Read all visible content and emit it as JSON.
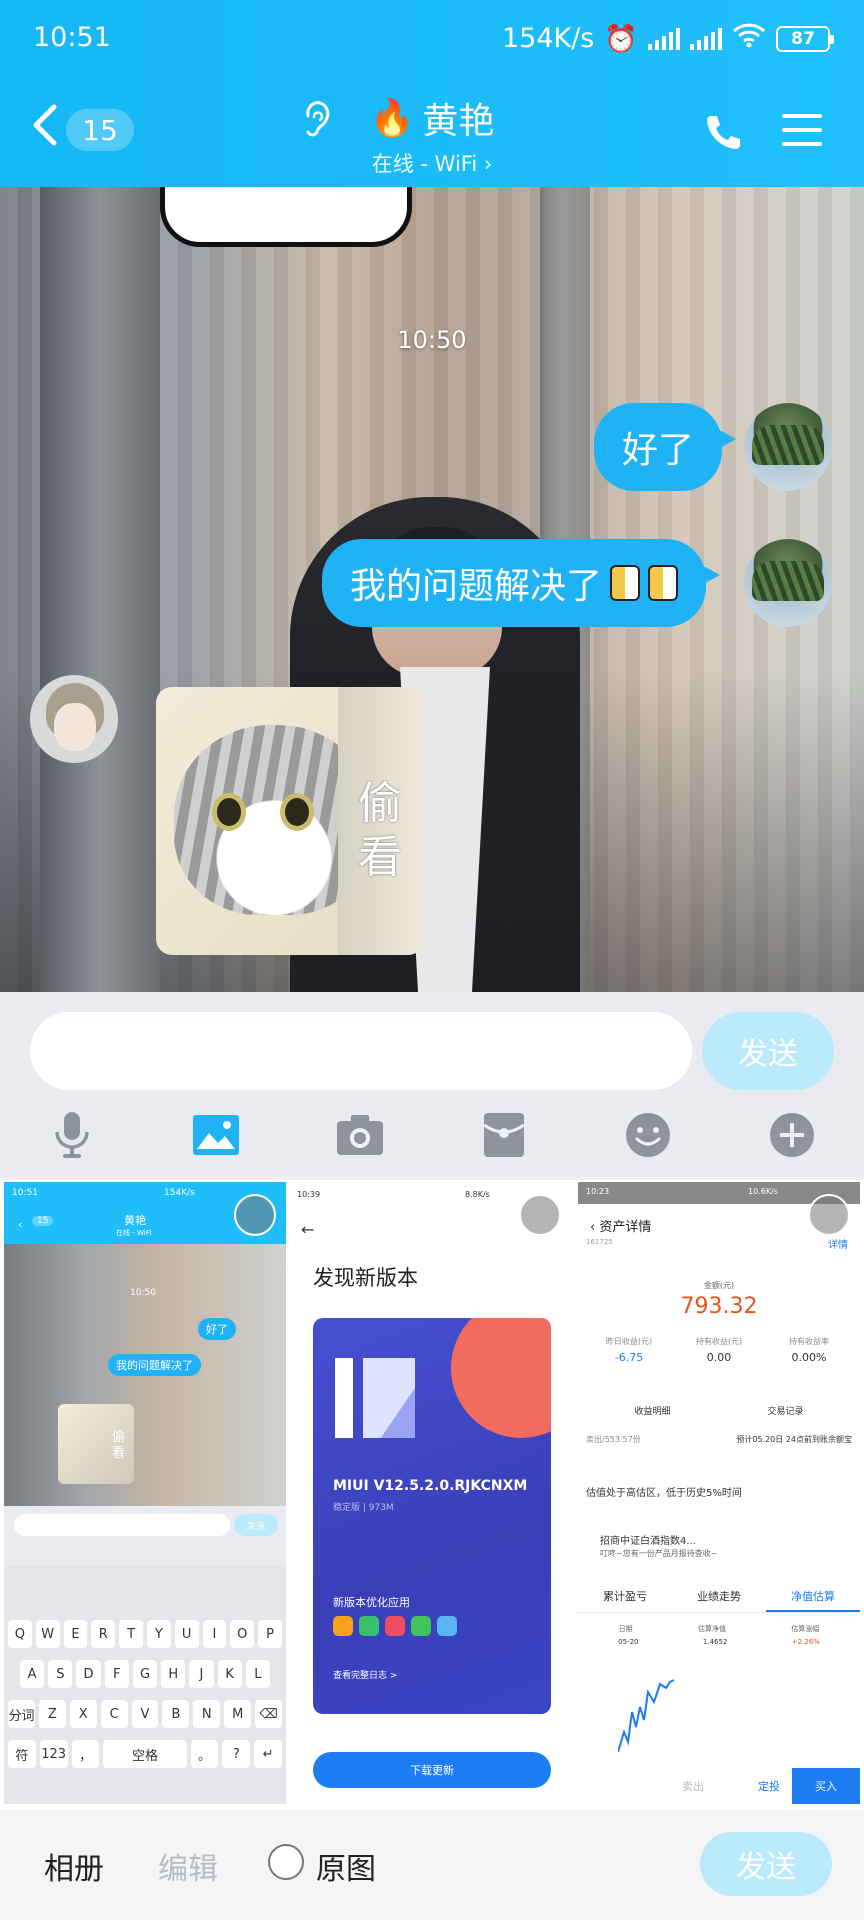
{
  "status_bar": {
    "time": "10:51",
    "speed": "154K/s",
    "battery": "87"
  },
  "header": {
    "unread_count": "15",
    "contact_name": "黄艳",
    "presence": "在线 - WiFi"
  },
  "chat": {
    "timestamp": "10:50",
    "messages": [
      {
        "sender": "me",
        "text": "好了"
      },
      {
        "sender": "me",
        "text": "我的问题解决了"
      },
      {
        "sender": "other",
        "sticker_text": "偷看"
      }
    ]
  },
  "composer": {
    "placeholder": "",
    "send_label": "发送"
  },
  "gallery": {
    "thumb1": {
      "time": "10:51",
      "speed": "154K/s",
      "name": "黄艳",
      "presence": "在线 - WiFi",
      "timestamp": "10:50",
      "bubble1": "好了",
      "bubble2": "我的问题解决了",
      "sticker": "偷看",
      "send": "发送",
      "keyboard_rows": [
        [
          "Q",
          "W",
          "E",
          "R",
          "T",
          "Y",
          "U",
          "I",
          "O",
          "P"
        ],
        [
          "A",
          "S",
          "D",
          "F",
          "G",
          "H",
          "J",
          "K",
          "L"
        ],
        [
          "分词",
          "Z",
          "X",
          "C",
          "V",
          "B",
          "N",
          "M",
          "⌫"
        ],
        [
          "符",
          "123",
          "，",
          "空格",
          "。",
          "?",
          "↵"
        ]
      ]
    },
    "thumb2": {
      "time": "10:39",
      "speed": "8.8K/s",
      "heading": "发现新版本",
      "version": "MIUI V12.5.2.0.RJKCNXM",
      "stable": "稳定版 | 973M",
      "optimized": "新版本优化应用",
      "log": "查看完整日志 >",
      "download": "下载更新"
    },
    "thumb3": {
      "time": "10:23",
      "speed": "10.6K/s",
      "title": "资产详情",
      "detail": "详情",
      "code": "161725",
      "amount_label": "金额(元)",
      "amount": "793.32",
      "stats": [
        {
          "label": "昨日收益(元)",
          "value": "-6.75"
        },
        {
          "label": "持有收益(元)",
          "value": "0.00"
        },
        {
          "label": "持有收益率",
          "value": "0.00%"
        }
      ],
      "links": [
        "收益明细",
        "交易记录"
      ],
      "sell_note": "卖出/553.57份",
      "expected": "预计05.20日 24点前到账余额宝",
      "valuation": "估值处于高估区，低于历史5%时间",
      "fund": "招商中证白酒指数4...",
      "fund_sub": "叮咚~您有一份产品月报待查收~",
      "tabs": [
        "累计盈亏",
        "业绩走势",
        "净值估算"
      ],
      "table_headers": [
        "日期",
        "估算净值",
        "估算涨幅"
      ],
      "table_values": [
        "05-20",
        "1.4652",
        "+2.26%"
      ],
      "buttons": {
        "sell": "卖出",
        "fixed": "定投",
        "buy": "买入"
      }
    }
  },
  "bottom_bar": {
    "album": "相册",
    "edit": "编辑",
    "original": "原图",
    "send": "发送"
  },
  "colors": {
    "accent": "#1FB2F4",
    "header": "#16B7F5",
    "send_disabled": "#B9E9FB",
    "price": "#E8541D"
  }
}
